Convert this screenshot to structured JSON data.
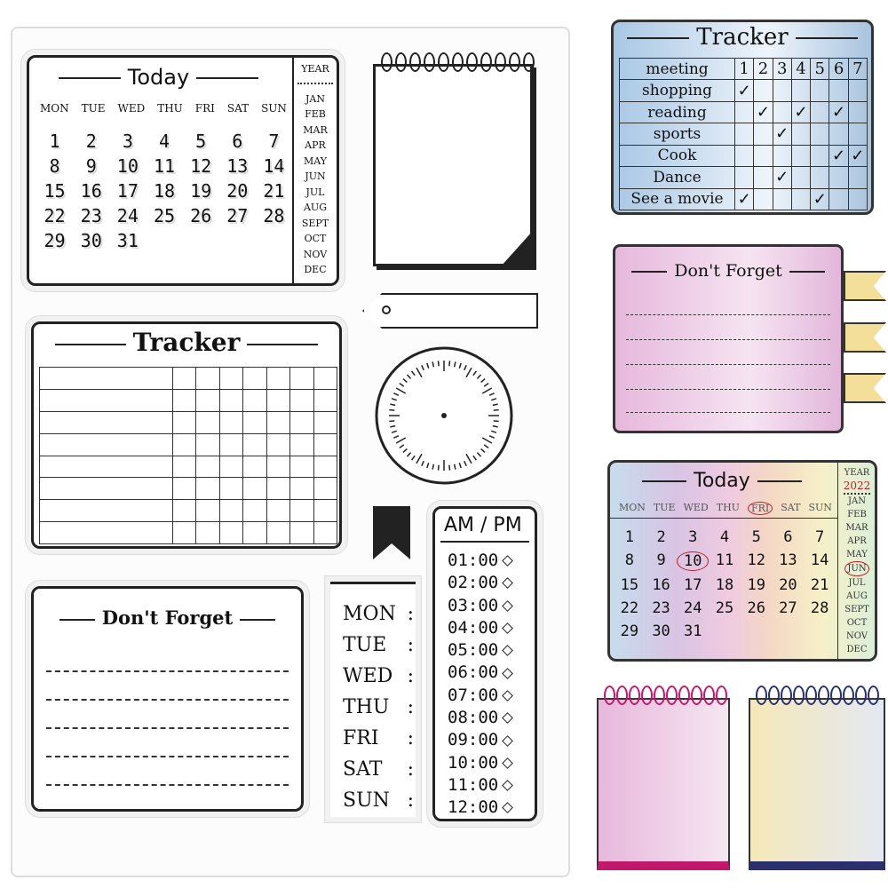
{
  "calendar_stamp": {
    "title": "Today",
    "weekdays": [
      "MON",
      "TUE",
      "WED",
      "THU",
      "FRI",
      "SAT",
      "SUN"
    ],
    "dates": [
      "1",
      "2",
      "3",
      "4",
      "5",
      "6",
      "7",
      "8",
      "9",
      "10",
      "11",
      "12",
      "13",
      "14",
      "15",
      "16",
      "17",
      "18",
      "19",
      "20",
      "21",
      "22",
      "23",
      "24",
      "25",
      "26",
      "27",
      "28",
      "29",
      "30",
      "31"
    ],
    "year_label": "YEAR",
    "months": [
      "JAN",
      "FEB",
      "MAR",
      "APR",
      "MAY",
      "JUN",
      "JUL",
      "AUG",
      "SEPT",
      "OCT",
      "NOV",
      "DEC"
    ]
  },
  "tracker_stamp": {
    "title": "Tracker"
  },
  "dont_forget_stamp": {
    "title": "Don't Forget"
  },
  "weekday_stamp": {
    "days": [
      "MON",
      "TUE",
      "WED",
      "THU",
      "FRI",
      "SAT",
      "SUN"
    ],
    "separator": ":"
  },
  "time_stamp": {
    "title": "AM / PM",
    "times": [
      "01:00",
      "02:00",
      "03:00",
      "04:00",
      "05:00",
      "06:00",
      "07:00",
      "08:00",
      "09:00",
      "10:00",
      "11:00",
      "12:00"
    ]
  },
  "colored_tracker": {
    "title": "Tracker",
    "columns": [
      "1",
      "2",
      "3",
      "4",
      "5",
      "6",
      "7"
    ],
    "rows": [
      {
        "label": "meeting",
        "checks": []
      },
      {
        "label": "shopping",
        "checks": [
          1
        ]
      },
      {
        "label": "reading",
        "checks": [
          2,
          4,
          6
        ]
      },
      {
        "label": "sports",
        "checks": [
          3
        ]
      },
      {
        "label": "Cook",
        "checks": [
          6,
          7
        ]
      },
      {
        "label": "Dance",
        "checks": [
          3
        ]
      },
      {
        "label": "See a movie",
        "checks": [
          1,
          5
        ]
      }
    ],
    "check_mark": "✓"
  },
  "colored_dont_forget": {
    "title": "Don't Forget"
  },
  "colored_calendar": {
    "title": "Today",
    "year_label": "YEAR",
    "year": "2022",
    "circled_day": "FRI",
    "circled_date": "10",
    "circled_month": "JUN"
  },
  "colors": {
    "tracker_bg": "#b9d3ea",
    "note_bg": "#e9c6e6",
    "pink_pad": "#c2186b",
    "navy_pad": "#2a2f6e",
    "circle_red": "#c0202a"
  }
}
